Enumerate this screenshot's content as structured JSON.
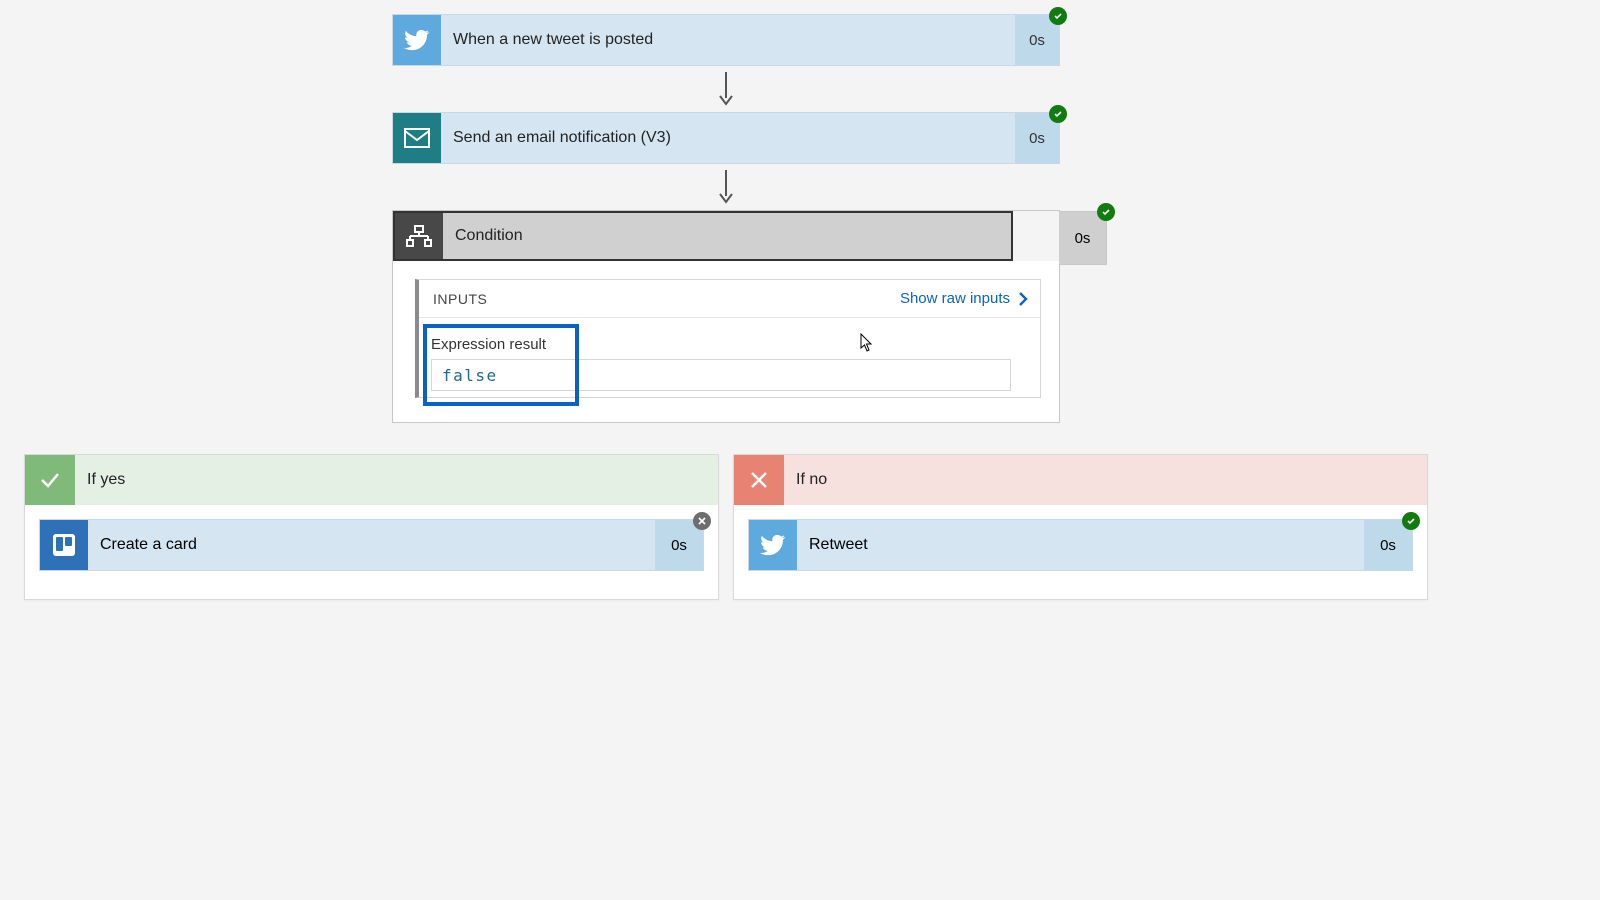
{
  "trigger": {
    "label": "When a new tweet is posted",
    "duration": "0s",
    "status": "success"
  },
  "action1": {
    "label": "Send an email notification (V3)",
    "duration": "0s",
    "status": "success"
  },
  "condition": {
    "label": "Condition",
    "duration": "0s",
    "status": "success",
    "inputs_title": "INPUTS",
    "show_raw_label": "Show raw inputs",
    "expression_label": "Expression result",
    "expression_value": "false"
  },
  "yes_branch": {
    "label": "If yes",
    "action": {
      "label": "Create a card",
      "duration": "0s",
      "status": "skipped"
    }
  },
  "no_branch": {
    "label": "If no",
    "action": {
      "label": "Retweet",
      "duration": "0s",
      "status": "success"
    }
  }
}
